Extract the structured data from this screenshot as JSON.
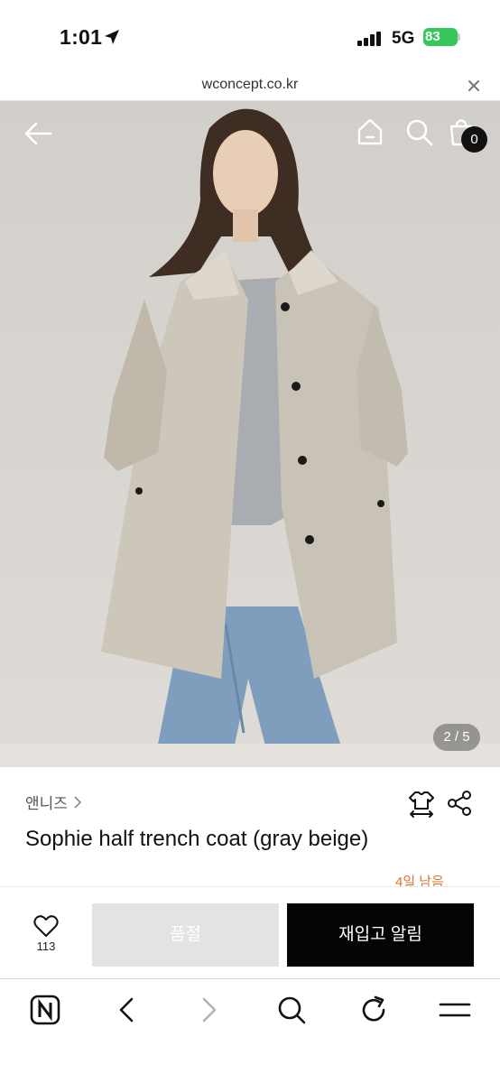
{
  "status_bar": {
    "time": "1:01",
    "network": "5G",
    "battery": "83"
  },
  "url_bar": {
    "domain": "wconcept.co.kr"
  },
  "hero": {
    "cart_count": "0",
    "image_counter": "2 / 5"
  },
  "product": {
    "brand": "앤니즈",
    "title": "Sophie half trench coat (gray beige)",
    "sale_note": "4일 남음"
  },
  "actions": {
    "like_count": "113",
    "soldout_label": "품절",
    "restock_label": "재입고 알림"
  },
  "colors": {
    "accent_orange": "#e0722f",
    "restock_button": "#050505",
    "soldout_button": "#e3e3e3",
    "battery_green": "#34c759"
  },
  "icons": [
    "location-arrow-icon",
    "signal-icon",
    "close-icon",
    "back-arrow-icon",
    "home-icon",
    "search-icon",
    "cart-icon",
    "chevron-right-icon",
    "size-guide-icon",
    "share-icon",
    "heart-icon",
    "naver-icon",
    "browser-back-icon",
    "browser-forward-icon",
    "browser-search-icon",
    "refresh-icon",
    "menu-icon"
  ]
}
